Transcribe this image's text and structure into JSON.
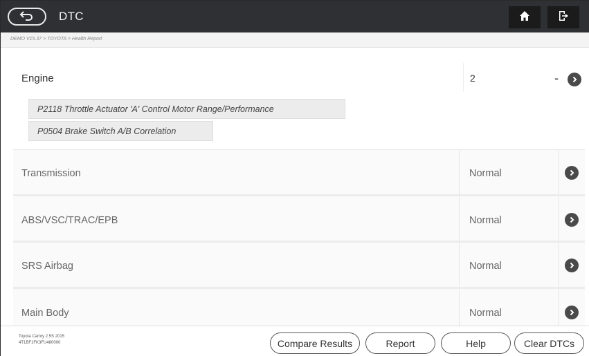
{
  "header": {
    "title": "DTC",
    "back_icon": "back-arrow-icon",
    "home_icon": "home-icon",
    "exit_icon": "exit-icon"
  },
  "breadcrumb": "DEMO V15.37 > TOYOTA > Health Report",
  "engine": {
    "name": "Engine",
    "count": "2",
    "collapse": "-",
    "codes": [
      "P2118 Throttle Actuator 'A' Control Motor Range/Performance",
      "P0504 Brake Switch A/B Correlation"
    ]
  },
  "systems": [
    {
      "name": "Transmission",
      "status": "Normal"
    },
    {
      "name": "ABS/VSC/TRAC/EPB",
      "status": "Normal"
    },
    {
      "name": "SRS Airbag",
      "status": "Normal"
    },
    {
      "name": "Main Body",
      "status": "Normal"
    }
  ],
  "footer": {
    "vehicle_line1": "Toyota Camry 2.5S 2015",
    "vehicle_line2": "4T1BF1FK3FU480000",
    "buttons": {
      "compare": "Compare Results",
      "report": "Report",
      "help": "Help",
      "clear": "Clear DTCs"
    }
  },
  "colors": {
    "titlebar": "#2f3033",
    "tb_button": "#1b1b1c",
    "arrow_circle": "#4a4a4a"
  }
}
